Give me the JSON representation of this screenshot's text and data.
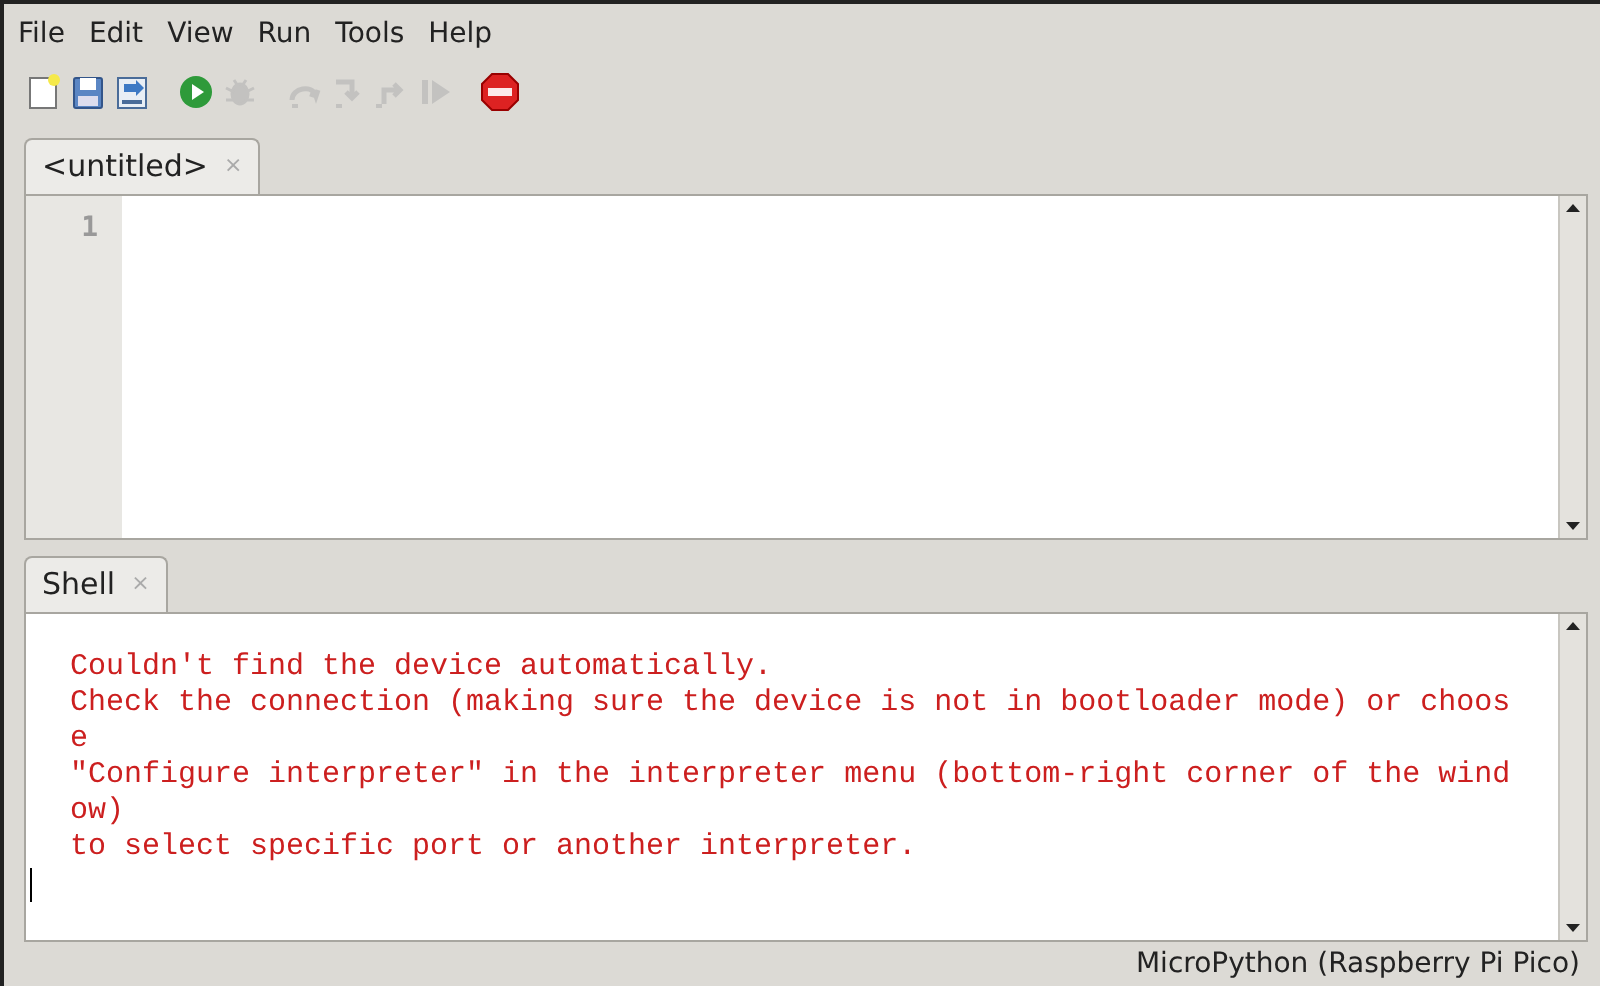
{
  "menu": [
    "File",
    "Edit",
    "View",
    "Run",
    "Tools",
    "Help"
  ],
  "toolbar": [
    {
      "kind": "new",
      "disabled": false
    },
    {
      "kind": "open",
      "disabled": false
    },
    {
      "kind": "save",
      "disabled": false
    },
    {
      "kind": "run",
      "disabled": false
    },
    {
      "kind": "debug",
      "disabled": true
    },
    {
      "kind": "step_over",
      "disabled": true
    },
    {
      "kind": "step_into",
      "disabled": true
    },
    {
      "kind": "step_out",
      "disabled": true
    },
    {
      "kind": "resume",
      "disabled": true
    },
    {
      "kind": "stop",
      "disabled": false
    }
  ],
  "editor": {
    "tabs": [
      {
        "label": "<untitled>",
        "close": "×",
        "selected": true
      }
    ],
    "line_numbers": [
      "1"
    ]
  },
  "shell": {
    "tabs": [
      {
        "label": "Shell",
        "close": "×",
        "selected": true
      }
    ],
    "lines": [
      "Couldn't find the device automatically.",
      "Check the connection (making sure the device is not in bootloader mode) or choos",
      "e",
      "\"Configure interpreter\" in the interpreter menu (bottom-right corner of the wind",
      "ow)",
      "to select specific port or another interpreter."
    ]
  },
  "status_bar": {
    "interpreter": "MicroPython (Raspberry Pi Pico)"
  }
}
